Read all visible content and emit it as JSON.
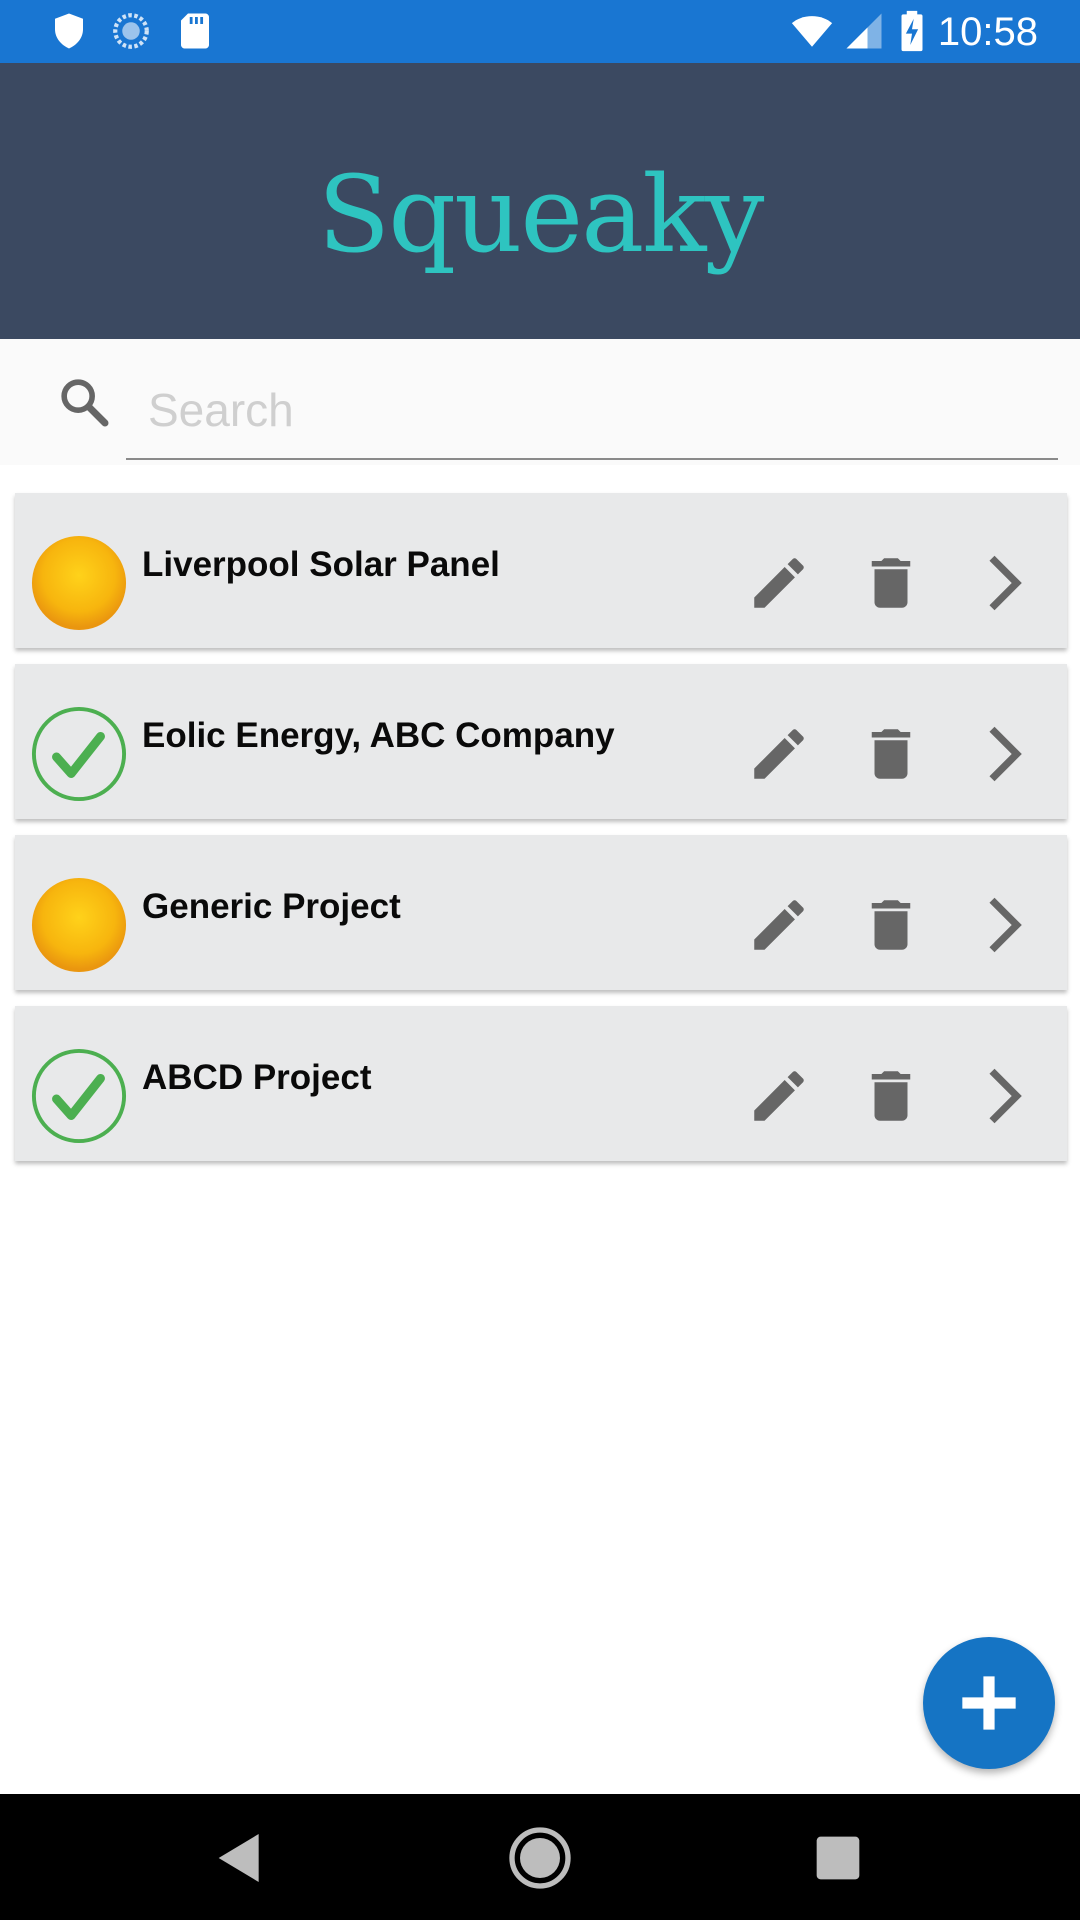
{
  "status_bar": {
    "time": "10:58",
    "left_icons": [
      "shield-icon",
      "sync-icon",
      "sd-card-icon"
    ],
    "right_icons": [
      "wifi-icon",
      "cellular-signal-icon",
      "battery-charging-icon"
    ]
  },
  "header": {
    "app_name": "Squeaky",
    "background_color": "#3b4961",
    "logo_color": "#2ec4c0"
  },
  "search": {
    "placeholder": "Search",
    "value": ""
  },
  "projects": [
    {
      "name": "Liverpool Solar Panel",
      "status": "pending"
    },
    {
      "name": "Eolic Energy, ABC Company",
      "status": "complete"
    },
    {
      "name": "Generic Project",
      "status": "pending"
    },
    {
      "name": "ABCD Project",
      "status": "complete"
    }
  ],
  "row_actions": [
    "edit-icon",
    "delete-icon",
    "chevron-right-icon"
  ],
  "fab": {
    "icon": "plus-icon",
    "color": "#1574c4"
  },
  "nav": [
    "back-icon",
    "home-icon",
    "recents-icon"
  ],
  "colors": {
    "status_bar": "#1976d2",
    "pending": "#f5b80f",
    "complete": "#4caf50",
    "row_background": "#e8e9ea"
  }
}
